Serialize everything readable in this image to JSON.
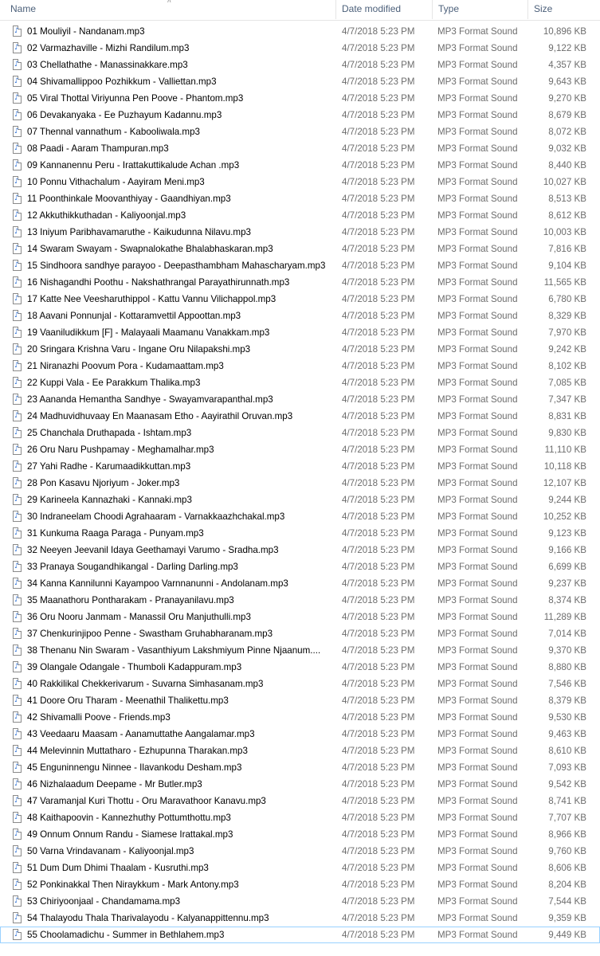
{
  "columns": {
    "name": "Name",
    "date": "Date modified",
    "type": "Type",
    "size": "Size"
  },
  "files": [
    {
      "name": "01 Mouliyil - Nandanam.mp3",
      "date": "4/7/2018 5:23 PM",
      "type": "MP3 Format Sound",
      "size": "10,896 KB"
    },
    {
      "name": "02 Varmazhaville - Mizhi Randilum.mp3",
      "date": "4/7/2018 5:23 PM",
      "type": "MP3 Format Sound",
      "size": "9,122 KB"
    },
    {
      "name": "03 Chellathathe - Manassinakkare.mp3",
      "date": "4/7/2018 5:23 PM",
      "type": "MP3 Format Sound",
      "size": "4,357 KB"
    },
    {
      "name": "04 Shivamallippoo Pozhikkum - Valliettan.mp3",
      "date": "4/7/2018 5:23 PM",
      "type": "MP3 Format Sound",
      "size": "9,643 KB"
    },
    {
      "name": "05 Viral Thottal Viriyunna Pen Poove - Phantom.mp3",
      "date": "4/7/2018 5:23 PM",
      "type": "MP3 Format Sound",
      "size": "9,270 KB"
    },
    {
      "name": "06 Devakanyaka - Ee Puzhayum Kadannu.mp3",
      "date": "4/7/2018 5:23 PM",
      "type": "MP3 Format Sound",
      "size": "8,679 KB"
    },
    {
      "name": "07 Thennal vannathum - Kabooliwala.mp3",
      "date": "4/7/2018 5:23 PM",
      "type": "MP3 Format Sound",
      "size": "8,072 KB"
    },
    {
      "name": "08 Paadi - Aaram Thampuran.mp3",
      "date": "4/7/2018 5:23 PM",
      "type": "MP3 Format Sound",
      "size": "9,032 KB"
    },
    {
      "name": "09 Kannanennu Peru - Irattakuttikalude Achan .mp3",
      "date": "4/7/2018 5:23 PM",
      "type": "MP3 Format Sound",
      "size": "8,440 KB"
    },
    {
      "name": "10 Ponnu Vithachalum - Aayiram Meni.mp3",
      "date": "4/7/2018 5:23 PM",
      "type": "MP3 Format Sound",
      "size": "10,027 KB"
    },
    {
      "name": "11 Poonthinkale Moovanthiyay - Gaandhiyan.mp3",
      "date": "4/7/2018 5:23 PM",
      "type": "MP3 Format Sound",
      "size": "8,513 KB"
    },
    {
      "name": "12 Akkuthikkuthadan - Kaliyoonjal.mp3",
      "date": "4/7/2018 5:23 PM",
      "type": "MP3 Format Sound",
      "size": "8,612 KB"
    },
    {
      "name": "13 Iniyum Paribhavamaruthe - Kaikudunna Nilavu.mp3",
      "date": "4/7/2018 5:23 PM",
      "type": "MP3 Format Sound",
      "size": "10,003 KB"
    },
    {
      "name": "14 Swaram Swayam - Swapnalokathe Bhalabhaskaran.mp3",
      "date": "4/7/2018 5:23 PM",
      "type": "MP3 Format Sound",
      "size": "7,816 KB"
    },
    {
      "name": "15 Sindhoora sandhye parayoo - Deepasthambham Mahascharyam.mp3",
      "date": "4/7/2018 5:23 PM",
      "type": "MP3 Format Sound",
      "size": "9,104 KB"
    },
    {
      "name": "16 Nishagandhi Poothu - Nakshathrangal Parayathirunnath.mp3",
      "date": "4/7/2018 5:23 PM",
      "type": "MP3 Format Sound",
      "size": "11,565 KB"
    },
    {
      "name": "17 Katte Nee Veesharuthippol - Kattu Vannu Vilichappol.mp3",
      "date": "4/7/2018 5:23 PM",
      "type": "MP3 Format Sound",
      "size": "6,780 KB"
    },
    {
      "name": "18 Aavani Ponnunjal - Kottaramvettil Appoottan.mp3",
      "date": "4/7/2018 5:23 PM",
      "type": "MP3 Format Sound",
      "size": "8,329 KB"
    },
    {
      "name": "19 Vaaniludikkum [F] - Malayaali Maamanu Vanakkam.mp3",
      "date": "4/7/2018 5:23 PM",
      "type": "MP3 Format Sound",
      "size": "7,970 KB"
    },
    {
      "name": "20 Sringara Krishna Varu - Ingane Oru Nilapakshi.mp3",
      "date": "4/7/2018 5:23 PM",
      "type": "MP3 Format Sound",
      "size": "9,242 KB"
    },
    {
      "name": "21 Niranazhi Poovum Pora - Kudamaattam.mp3",
      "date": "4/7/2018 5:23 PM",
      "type": "MP3 Format Sound",
      "size": "8,102 KB"
    },
    {
      "name": "22 Kuppi Vala - Ee Parakkum Thalika.mp3",
      "date": "4/7/2018 5:23 PM",
      "type": "MP3 Format Sound",
      "size": "7,085 KB"
    },
    {
      "name": "23 Aananda Hemantha Sandhye - Swayamvarapanthal.mp3",
      "date": "4/7/2018 5:23 PM",
      "type": "MP3 Format Sound",
      "size": "7,347 KB"
    },
    {
      "name": "24 Madhuvidhuvaay En Maanasam Etho - Aayirathil Oruvan.mp3",
      "date": "4/7/2018 5:23 PM",
      "type": "MP3 Format Sound",
      "size": "8,831 KB"
    },
    {
      "name": "25 Chanchala Druthapada - Ishtam.mp3",
      "date": "4/7/2018 5:23 PM",
      "type": "MP3 Format Sound",
      "size": "9,830 KB"
    },
    {
      "name": "26 Oru Naru Pushpamay - Meghamalhar.mp3",
      "date": "4/7/2018 5:23 PM",
      "type": "MP3 Format Sound",
      "size": "11,110 KB"
    },
    {
      "name": "27 Yahi Radhe - Karumaadikkuttan.mp3",
      "date": "4/7/2018 5:23 PM",
      "type": "MP3 Format Sound",
      "size": "10,118 KB"
    },
    {
      "name": "28 Pon Kasavu Njoriyum - Joker.mp3",
      "date": "4/7/2018 5:23 PM",
      "type": "MP3 Format Sound",
      "size": "12,107 KB"
    },
    {
      "name": "29 Karineela Kannazhaki - Kannaki.mp3",
      "date": "4/7/2018 5:23 PM",
      "type": "MP3 Format Sound",
      "size": "9,244 KB"
    },
    {
      "name": "30 Indraneelam Choodi Agrahaaram - Varnakkaazhchakal.mp3",
      "date": "4/7/2018 5:23 PM",
      "type": "MP3 Format Sound",
      "size": "10,252 KB"
    },
    {
      "name": "31 Kunkuma Raaga Paraga - Punyam.mp3",
      "date": "4/7/2018 5:23 PM",
      "type": "MP3 Format Sound",
      "size": "9,123 KB"
    },
    {
      "name": "32 Neeyen Jeevanil Idaya Geethamayi Varumo - Sradha.mp3",
      "date": "4/7/2018 5:23 PM",
      "type": "MP3 Format Sound",
      "size": "9,166 KB"
    },
    {
      "name": "33 Pranaya Sougandhikangal - Darling Darling.mp3",
      "date": "4/7/2018 5:23 PM",
      "type": "MP3 Format Sound",
      "size": "6,699 KB"
    },
    {
      "name": "34 Kanna Kannilunni Kayampoo Varnnanunni - Andolanam.mp3",
      "date": "4/7/2018 5:23 PM",
      "type": "MP3 Format Sound",
      "size": "9,237 KB"
    },
    {
      "name": "35 Maanathoru Pontharakam - Pranayanilavu.mp3",
      "date": "4/7/2018 5:23 PM",
      "type": "MP3 Format Sound",
      "size": "8,374 KB"
    },
    {
      "name": "36 Oru Nooru Janmam - Manassil Oru Manjuthulli.mp3",
      "date": "4/7/2018 5:23 PM",
      "type": "MP3 Format Sound",
      "size": "11,289 KB"
    },
    {
      "name": "37 Chenkurinjipoo Penne - Swastham Gruhabharanam.mp3",
      "date": "4/7/2018 5:23 PM",
      "type": "MP3 Format Sound",
      "size": "7,014 KB"
    },
    {
      "name": "38 Thenanu Nin Swaram - Vasanthiyum Lakshmiyum Pinne Njaanum....",
      "date": "4/7/2018 5:23 PM",
      "type": "MP3 Format Sound",
      "size": "9,370 KB"
    },
    {
      "name": "39 Olangale Odangale - Thumboli Kadappuram.mp3",
      "date": "4/7/2018 5:23 PM",
      "type": "MP3 Format Sound",
      "size": "8,880 KB"
    },
    {
      "name": "40 Rakkilikal Chekkerivarum - Suvarna Simhasanam.mp3",
      "date": "4/7/2018 5:23 PM",
      "type": "MP3 Format Sound",
      "size": "7,546 KB"
    },
    {
      "name": "41 Doore Oru Tharam - Meenathil Thalikettu.mp3",
      "date": "4/7/2018 5:23 PM",
      "type": "MP3 Format Sound",
      "size": "8,379 KB"
    },
    {
      "name": "42 Shivamalli Poove - Friends.mp3",
      "date": "4/7/2018 5:23 PM",
      "type": "MP3 Format Sound",
      "size": "9,530 KB"
    },
    {
      "name": "43 Veedaaru Maasam - Aanamuttathe Aangalamar.mp3",
      "date": "4/7/2018 5:23 PM",
      "type": "MP3 Format Sound",
      "size": "9,463 KB"
    },
    {
      "name": "44 Melevinnin Muttatharo - Ezhupunna Tharakan.mp3",
      "date": "4/7/2018 5:23 PM",
      "type": "MP3 Format Sound",
      "size": "8,610 KB"
    },
    {
      "name": "45 Enguninnengu Ninnee - Ilavankodu Desham.mp3",
      "date": "4/7/2018 5:23 PM",
      "type": "MP3 Format Sound",
      "size": "7,093 KB"
    },
    {
      "name": "46 Nizhalaadum Deepame - Mr Butler.mp3",
      "date": "4/7/2018 5:23 PM",
      "type": "MP3 Format Sound",
      "size": "9,542 KB"
    },
    {
      "name": "47 Varamanjal Kuri Thottu - Oru Maravathoor Kanavu.mp3",
      "date": "4/7/2018 5:23 PM",
      "type": "MP3 Format Sound",
      "size": "8,741 KB"
    },
    {
      "name": "48 Kaithapoovin - Kannezhuthy Pottumthottu.mp3",
      "date": "4/7/2018 5:23 PM",
      "type": "MP3 Format Sound",
      "size": "7,707 KB"
    },
    {
      "name": "49 Onnum Onnum Randu - Siamese Irattakal.mp3",
      "date": "4/7/2018 5:23 PM",
      "type": "MP3 Format Sound",
      "size": "8,966 KB"
    },
    {
      "name": "50 Varna Vrindavanam - Kaliyoonjal.mp3",
      "date": "4/7/2018 5:23 PM",
      "type": "MP3 Format Sound",
      "size": "9,760 KB"
    },
    {
      "name": "51 Dum Dum Dhimi Thaalam - Kusruthi.mp3",
      "date": "4/7/2018 5:23 PM",
      "type": "MP3 Format Sound",
      "size": "8,606 KB"
    },
    {
      "name": "52 Ponkinakkal Then Niraykkum - Mark Antony.mp3",
      "date": "4/7/2018 5:23 PM",
      "type": "MP3 Format Sound",
      "size": "8,204 KB"
    },
    {
      "name": "53 Chiriyoonjaal - Chandamama.mp3",
      "date": "4/7/2018 5:23 PM",
      "type": "MP3 Format Sound",
      "size": "7,544 KB"
    },
    {
      "name": "54 Thalayodu Thala Tharivalayodu - Kalyanappittennu.mp3",
      "date": "4/7/2018 5:23 PM",
      "type": "MP3 Format Sound",
      "size": "9,359 KB"
    },
    {
      "name": "55 Choolamadichu - Summer in Bethlahem.mp3",
      "date": "4/7/2018 5:23 PM",
      "type": "MP3 Format Sound",
      "size": "9,449 KB"
    }
  ],
  "selected_index": 54,
  "icon": "music-file-icon",
  "colors": {
    "header_text": "#4c607a",
    "detail_text": "#6d6d6d",
    "selection_border": "#99d1ff",
    "icon_accent": "#2b6fd6"
  }
}
